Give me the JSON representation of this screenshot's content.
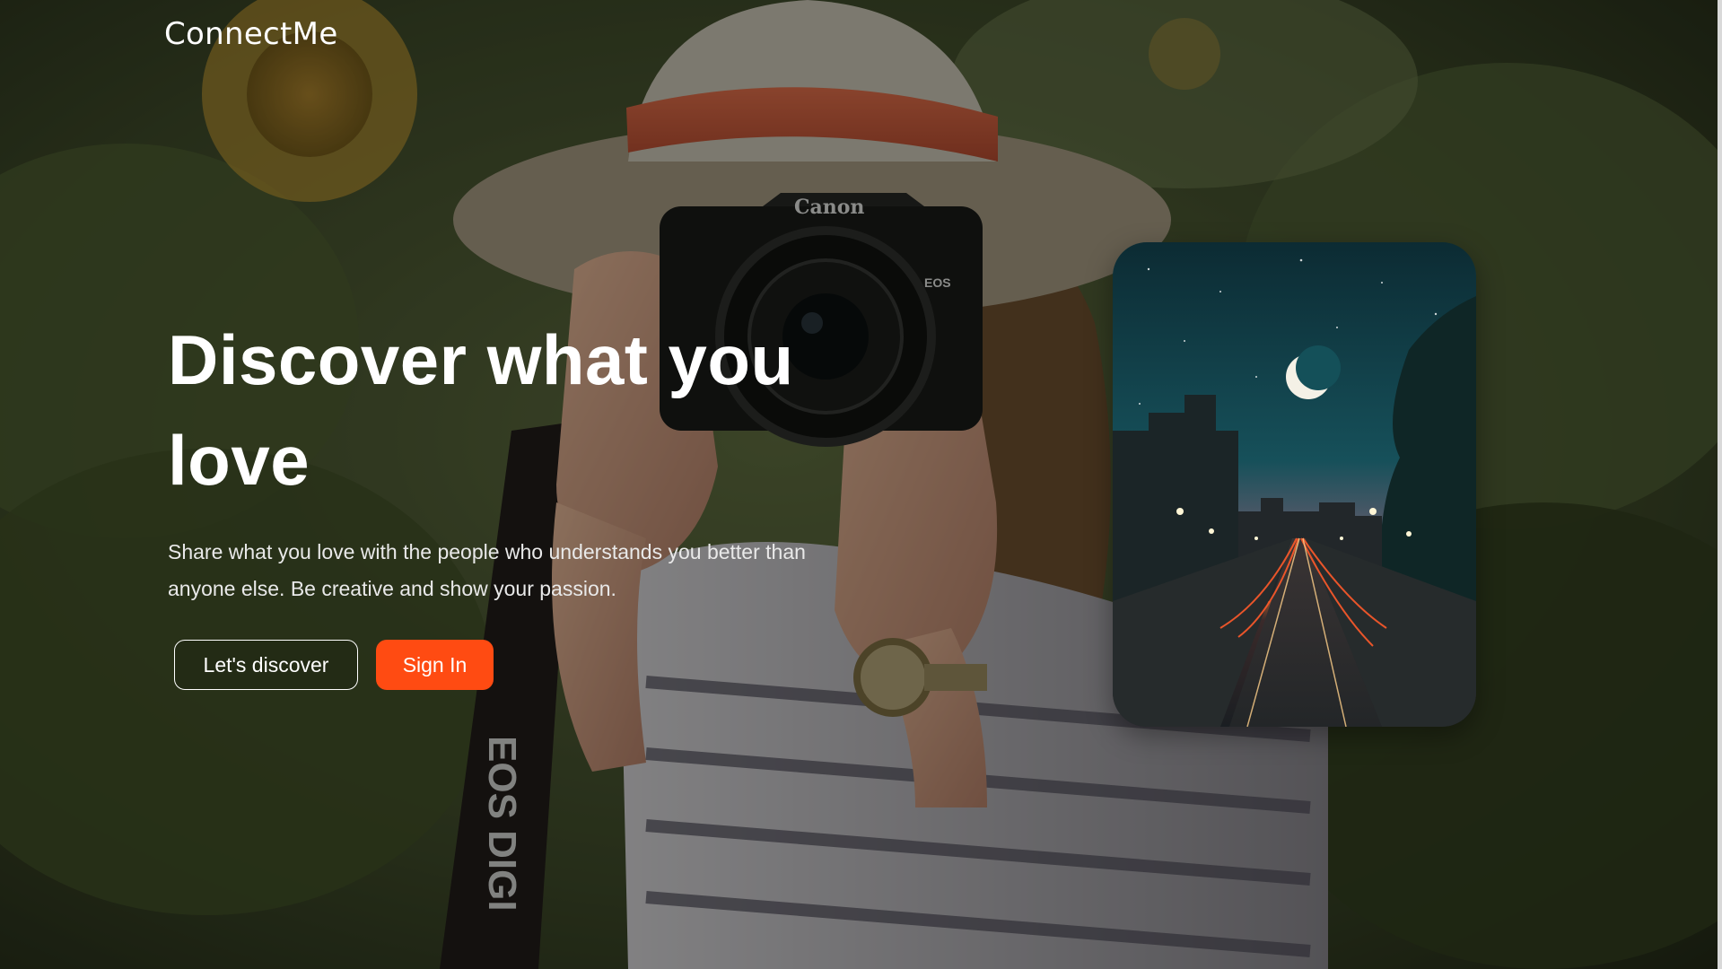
{
  "brand": {
    "name": "ConnectMe"
  },
  "hero": {
    "title": "Discover what you love",
    "subtitle": "Share what you love with the people who understands you better than anyone else. Be creative and show your passion.",
    "actions": {
      "discover_label": "Let's discover",
      "signin_label": "Sign In"
    }
  },
  "background": {
    "camera_brand": "Canon",
    "strap_text": "EOS DIGI",
    "camera_badge": "EOS"
  },
  "colors": {
    "accent": "#ff4b12",
    "text": "#ffffff",
    "subtitle": "#e9e9e9"
  }
}
